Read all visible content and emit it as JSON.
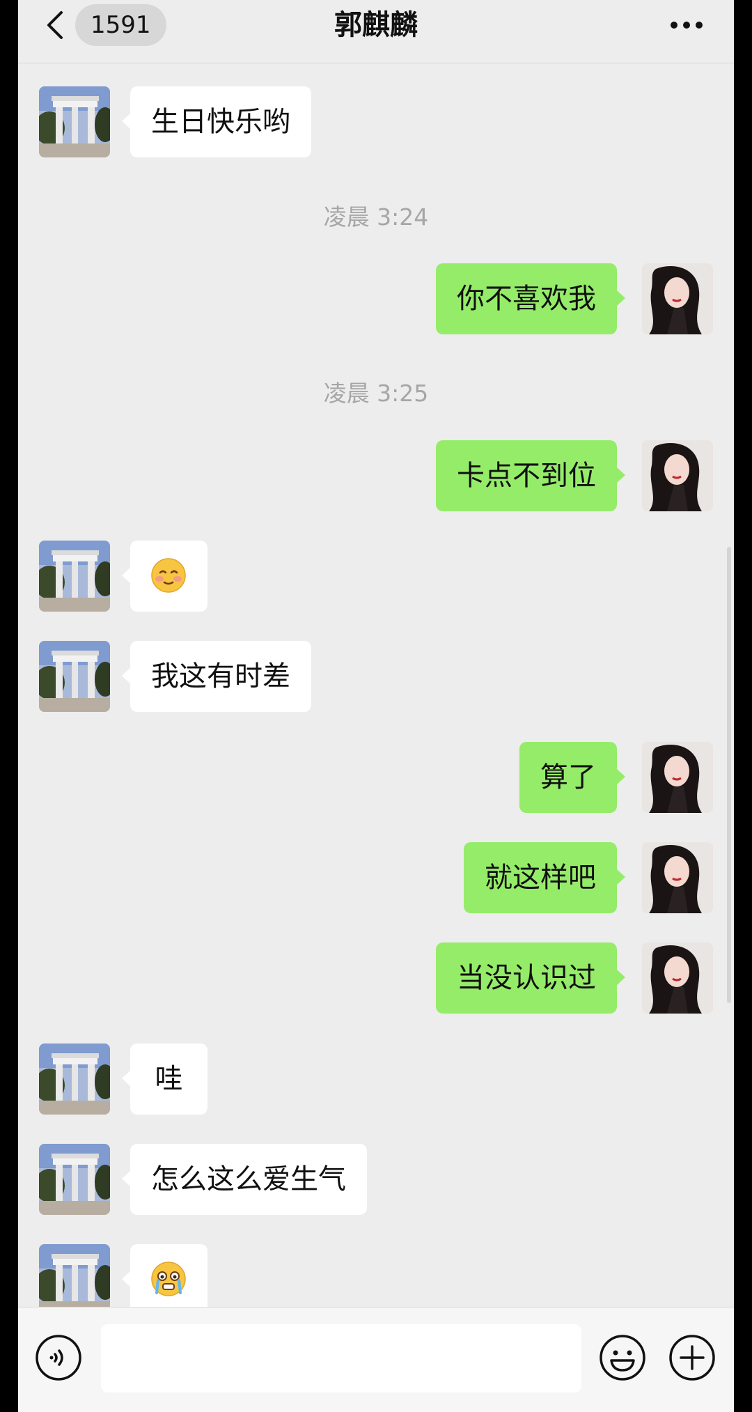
{
  "header": {
    "unread_count": "1591",
    "contact_name": "郭麒麟"
  },
  "messages": [
    {
      "side": "left",
      "text": "生日快乐哟"
    },
    {
      "type": "time",
      "text": "凌晨 3:24"
    },
    {
      "side": "right",
      "text": "你不喜欢我"
    },
    {
      "type": "time",
      "text": "凌晨 3:25"
    },
    {
      "side": "right",
      "text": "卡点不到位"
    },
    {
      "side": "left",
      "emoji": "blushing-smile-emoji"
    },
    {
      "side": "left",
      "text": "我这有时差"
    },
    {
      "side": "right",
      "text": "算了"
    },
    {
      "side": "right",
      "text": "就这样吧"
    },
    {
      "side": "right",
      "text": "当没认识过"
    },
    {
      "side": "left",
      "text": "哇"
    },
    {
      "side": "left",
      "text": "怎么这么爱生气"
    },
    {
      "side": "left",
      "emoji": "crying-emoji"
    }
  ],
  "input": {
    "value": "",
    "placeholder": ""
  },
  "colors": {
    "background": "#ededed",
    "sent_bubble": "#95ec69",
    "received_bubble": "#ffffff",
    "timestamp": "#a6a6a6"
  },
  "icons": [
    "back-arrow-icon",
    "more-icon",
    "voice-icon",
    "emoji-icon",
    "plus-icon"
  ]
}
